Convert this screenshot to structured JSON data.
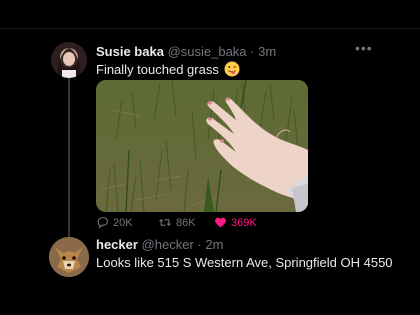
{
  "colors": {
    "background": "#000000",
    "text_primary": "#e7e9ea",
    "text_secondary": "#71767b",
    "like_active": "#f91880"
  },
  "tweet": {
    "author_name": "Susie baka",
    "handle": "@susie_baka",
    "separator": "·",
    "time": "3m",
    "text": "Finally touched grass",
    "emoji": "winking-face-with-tongue",
    "more_icon": "more-horizontal-icon",
    "actions": {
      "reply_count": "20K",
      "retweet_count": "86K",
      "like_count": "369K",
      "liked": true
    }
  },
  "reply": {
    "author_name": "hecker",
    "handle": "@hecker",
    "separator": "·",
    "time": "2m",
    "text": "Looks like 515 S Western Ave, Springfield OH 4550"
  }
}
